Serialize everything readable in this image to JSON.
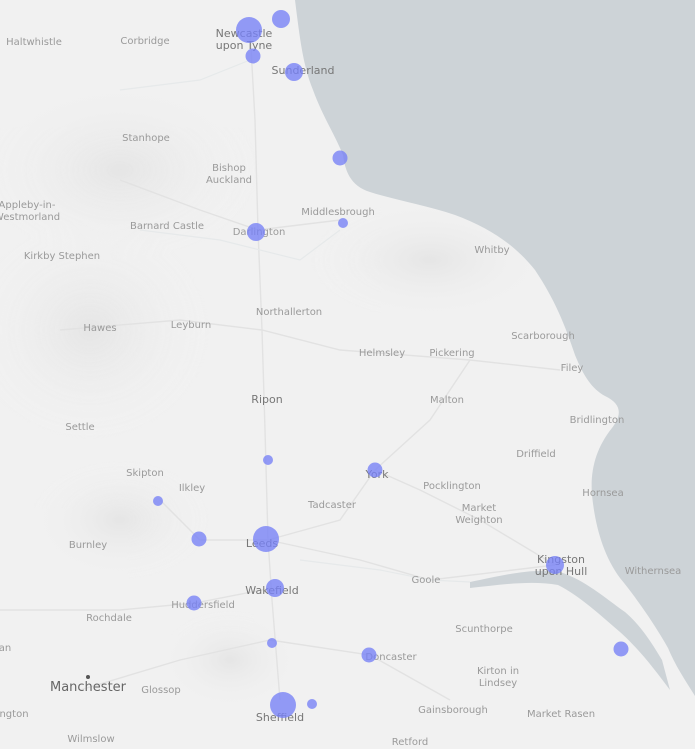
{
  "map": {
    "colors": {
      "land": "#f1f1f1",
      "sea": "#cdd3d7",
      "road": "#e6e6e6",
      "marker": "#7680f6",
      "label": "#8c8c8c"
    },
    "places": [
      {
        "id": "haltwhistle",
        "label": "Haltwhistle"
      },
      {
        "id": "corbridge",
        "label": "Corbridge"
      },
      {
        "id": "newcastle",
        "label": "Newcastle\nupon Tyne"
      },
      {
        "id": "sunderland",
        "label": "Sunderland"
      },
      {
        "id": "stanhope",
        "label": "Stanhope"
      },
      {
        "id": "bishop-auckland",
        "label": "Bishop\nAuckland"
      },
      {
        "id": "appleby",
        "label": "Appleby-in-\nWestmorland"
      },
      {
        "id": "barnard-castle",
        "label": "Barnard Castle"
      },
      {
        "id": "darlington",
        "label": "Darlington"
      },
      {
        "id": "middlesbrough",
        "label": "Middlesbrough"
      },
      {
        "id": "whitby",
        "label": "Whitby"
      },
      {
        "id": "kirkby-stephen",
        "label": "Kirkby Stephen"
      },
      {
        "id": "hawes",
        "label": "Hawes"
      },
      {
        "id": "leyburn",
        "label": "Leyburn"
      },
      {
        "id": "northallerton",
        "label": "Northallerton"
      },
      {
        "id": "scarborough",
        "label": "Scarborough"
      },
      {
        "id": "helmsley",
        "label": "Helmsley"
      },
      {
        "id": "pickering",
        "label": "Pickering"
      },
      {
        "id": "filey",
        "label": "Filey"
      },
      {
        "id": "ripon",
        "label": "Ripon"
      },
      {
        "id": "malton",
        "label": "Malton"
      },
      {
        "id": "settle",
        "label": "Settle"
      },
      {
        "id": "bridlington",
        "label": "Bridlington"
      },
      {
        "id": "driffield",
        "label": "Driffield"
      },
      {
        "id": "skipton",
        "label": "Skipton"
      },
      {
        "id": "york",
        "label": "York"
      },
      {
        "id": "ilkley",
        "label": "Ilkley"
      },
      {
        "id": "pocklington",
        "label": "Pocklington"
      },
      {
        "id": "hornsea",
        "label": "Hornsea"
      },
      {
        "id": "tadcaster",
        "label": "Tadcaster"
      },
      {
        "id": "market-weighton",
        "label": "Market\nWeighton"
      },
      {
        "id": "burnley",
        "label": "Burnley"
      },
      {
        "id": "leeds",
        "label": "Leeds"
      },
      {
        "id": "kingston",
        "label": "Kingston\nupon Hull"
      },
      {
        "id": "withernsea",
        "label": "Withernsea"
      },
      {
        "id": "goole",
        "label": "Goole"
      },
      {
        "id": "wakefield",
        "label": "Wakefield"
      },
      {
        "id": "huddersfield",
        "label": "Huddersfield"
      },
      {
        "id": "rochdale",
        "label": "Rochdale"
      },
      {
        "id": "scunthorpe",
        "label": "Scunthorpe"
      },
      {
        "id": "doncaster",
        "label": "Doncaster"
      },
      {
        "id": "kirton",
        "label": "Kirton in\nLindsey"
      },
      {
        "id": "manchester",
        "label": "Manchester"
      },
      {
        "id": "glossop",
        "label": "Glossop"
      },
      {
        "id": "sheffield",
        "label": "Sheffield"
      },
      {
        "id": "gainsborough",
        "label": "Gainsborough"
      },
      {
        "id": "market-rasen",
        "label": "Market Rasen"
      },
      {
        "id": "wilmslow",
        "label": "Wilmslow"
      },
      {
        "id": "retford",
        "label": "Retford"
      },
      {
        "id": "edge-an",
        "label": "an"
      },
      {
        "id": "edge-ngton",
        "label": "ngton"
      }
    ],
    "markers": [
      {
        "id": "newcastle",
        "size": "large"
      },
      {
        "id": "tynemouth",
        "size": "medium"
      },
      {
        "id": "gateshead",
        "size": "small"
      },
      {
        "id": "sunderland",
        "size": "medium"
      },
      {
        "id": "hartlepool",
        "size": "small"
      },
      {
        "id": "middlesbrough",
        "size": "tiny"
      },
      {
        "id": "darlington",
        "size": "medium"
      },
      {
        "id": "harrogate",
        "size": "tiny"
      },
      {
        "id": "york",
        "size": "small"
      },
      {
        "id": "keighley",
        "size": "tiny"
      },
      {
        "id": "bradford",
        "size": "small"
      },
      {
        "id": "leeds",
        "size": "large"
      },
      {
        "id": "wakefield",
        "size": "medium"
      },
      {
        "id": "huddersfield",
        "size": "small"
      },
      {
        "id": "barnsley",
        "size": "tiny"
      },
      {
        "id": "doncaster",
        "size": "small"
      },
      {
        "id": "sheffield",
        "size": "large"
      },
      {
        "id": "rotherham",
        "size": "tiny"
      },
      {
        "id": "hull",
        "size": "medium"
      },
      {
        "id": "grimsby",
        "size": "small"
      }
    ]
  }
}
